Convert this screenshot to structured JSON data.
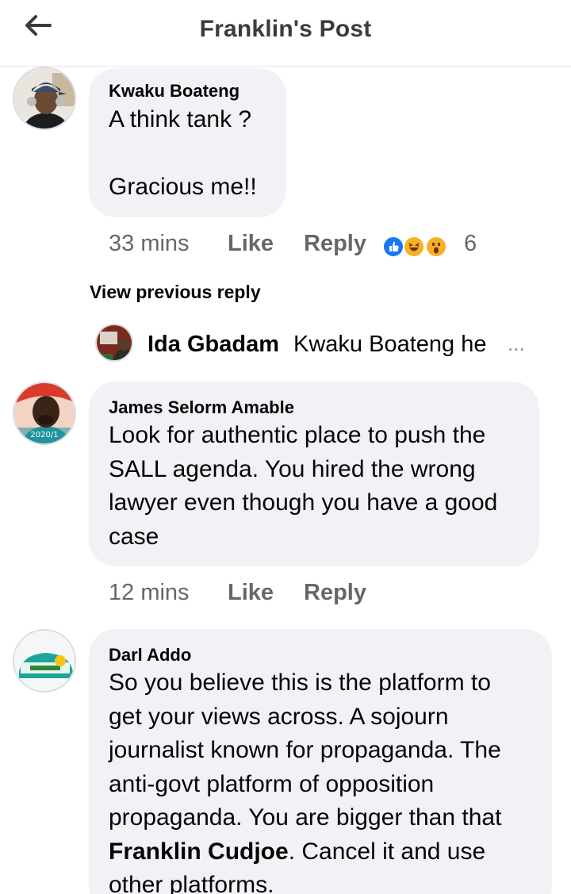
{
  "header": {
    "title": "Franklin's Post",
    "back_icon": "arrow-left-icon"
  },
  "comments": [
    {
      "author": "Kwaku Boateng",
      "lines": [
        "A think tank ?",
        "",
        "Gracious me!!"
      ],
      "time": "33 mins",
      "like_label": "Like",
      "reply_label": "Reply",
      "reaction_icons": [
        "like-reaction-icon",
        "haha-reaction-icon",
        "wow-reaction-icon"
      ],
      "reaction_count": "6"
    },
    {
      "author": "James Selorm Amable",
      "lines": [
        "Look for authentic place to push the",
        "SALL agenda. You hired the wrong",
        "lawyer even though you have a good",
        "case"
      ],
      "avatar_tag": "2020/1",
      "time": "12 mins",
      "like_label": "Like",
      "reply_label": "Reply"
    },
    {
      "author": "Darl Addo",
      "lines": [
        "So you believe this is the platform to",
        "get your views across. A sojourn",
        "journalist known for propaganda. The",
        "anti-govt platform of opposition",
        "propaganda. You are bigger than that"
      ],
      "mention": "Franklin Cudjoe",
      "after_mention": ". Cancel it and use",
      "last_line": "other platforms."
    }
  ],
  "view_previous": "View previous reply",
  "reply_preview": {
    "author": "Ida Gbadam",
    "snippet": "Kwaku Boateng he",
    "ellipsis": "..."
  },
  "colors": {
    "bubble": "#f0f2f5",
    "meta": "#65676b",
    "like_blue": "#1877f2",
    "reaction_yellow": "#f7b125"
  }
}
